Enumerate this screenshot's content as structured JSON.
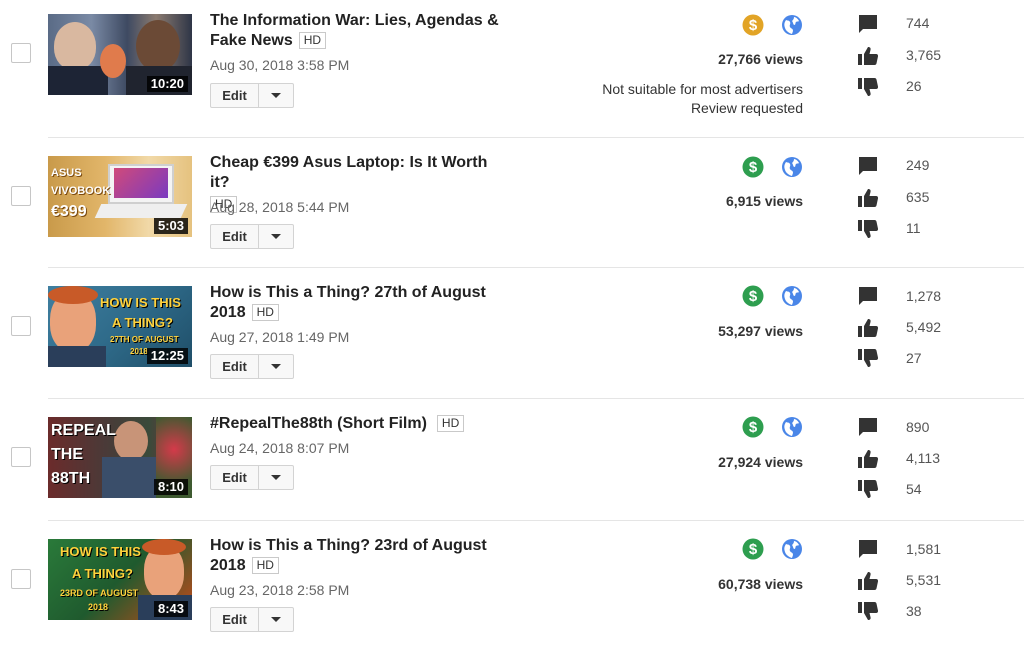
{
  "colors": {
    "monetized_green": "#2e9e4f",
    "monetized_limited_yellow": "#e2a426",
    "globe_blue": "#4a86e8"
  },
  "videos": [
    {
      "title_line1": "The Information War: Lies, Agendas &",
      "title_line2": "Fake News",
      "hd": "HD",
      "date": "Aug 30, 2018 3:58 PM",
      "edit": "Edit",
      "duration": "10:20",
      "views": "27,766 views",
      "monetization": "limited",
      "note_line1": "Not suitable for most advertisers",
      "note_line2": "Review requested",
      "comments": "744",
      "likes": "3,765",
      "dislikes": "26"
    },
    {
      "title_line1": "Cheap €399 Asus Laptop: Is It Worth it?",
      "title_line2": "",
      "hd": "HD",
      "date": "Aug 28, 2018 5:44 PM",
      "edit": "Edit",
      "duration": "5:03",
      "thumb_text": [
        "ASUS",
        "VIVOBOOK",
        "€399"
      ],
      "views": "6,915 views",
      "monetization": "on",
      "comments": "249",
      "likes": "635",
      "dislikes": "11"
    },
    {
      "title_line1": "How is This a Thing? 27th of August",
      "title_line2": "2018",
      "hd": "HD",
      "date": "Aug 27, 2018 1:49 PM",
      "edit": "Edit",
      "duration": "12:25",
      "thumb_text": [
        "HOW IS THIS",
        "A THING?",
        "27TH OF AUGUST",
        "2018"
      ],
      "views": "53,297 views",
      "monetization": "on",
      "comments": "1,278",
      "likes": "5,492",
      "dislikes": "27"
    },
    {
      "title_line1": "#RepealThe88th (Short Film)",
      "title_line2": "",
      "hd": "HD",
      "date": "Aug 24, 2018 8:07 PM",
      "edit": "Edit",
      "duration": "8:10",
      "thumb_text": [
        "REPEAL",
        "THE",
        "88TH"
      ],
      "views": "27,924 views",
      "monetization": "on",
      "comments": "890",
      "likes": "4,113",
      "dislikes": "54"
    },
    {
      "title_line1": "How is This a Thing? 23rd of August",
      "title_line2": "2018",
      "hd": "HD",
      "date": "Aug 23, 2018 2:58 PM",
      "edit": "Edit",
      "duration": "8:43",
      "thumb_text": [
        "HOW IS THIS",
        "A THING?",
        "23RD OF AUGUST",
        "2018"
      ],
      "views": "60,738 views",
      "monetization": "on",
      "comments": "1,581",
      "likes": "5,531",
      "dislikes": "38"
    }
  ]
}
